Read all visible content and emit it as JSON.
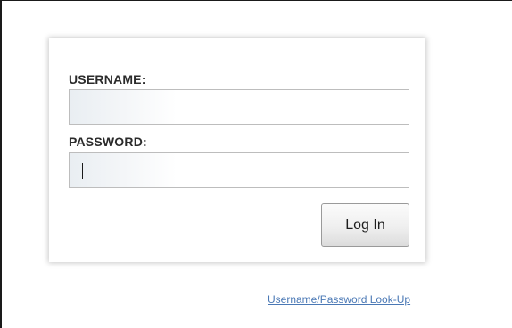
{
  "login": {
    "username_label": "USERNAME:",
    "username_value": "",
    "password_label": "PASSWORD:",
    "password_value": "",
    "login_button_label": "Log In"
  },
  "footer": {
    "lookup_link_label": "Username/Password Look-Up"
  },
  "colors": {
    "link": "#4a78b5",
    "label_text": "#2b2b2b",
    "field_border": "#bdbdbd"
  }
}
